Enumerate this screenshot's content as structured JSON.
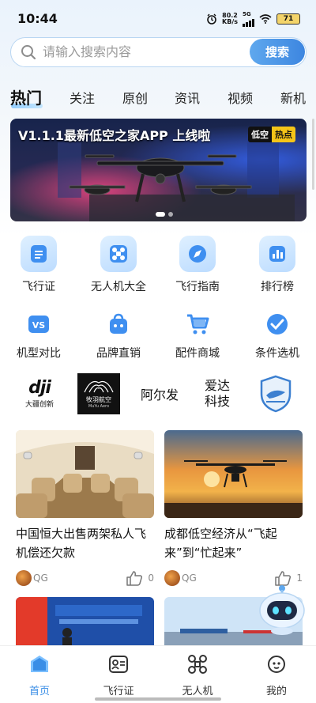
{
  "status_bar": {
    "time": "10:44",
    "net_speed_value": "80.2",
    "net_speed_unit": "KB/s",
    "network_type": "5G",
    "battery": "71"
  },
  "search": {
    "placeholder": "请输入搜索内容",
    "button_label": "搜索"
  },
  "tabs": [
    {
      "label": "热门",
      "active": true
    },
    {
      "label": "关注"
    },
    {
      "label": "原创"
    },
    {
      "label": "资讯"
    },
    {
      "label": "视频"
    },
    {
      "label": "新机"
    }
  ],
  "banner": {
    "title": "V1.1.1最新低空之家APP 上线啦",
    "tag_left": "低空",
    "tag_right": "热点"
  },
  "features": [
    {
      "label": "飞行证",
      "icon": "certificate-icon"
    },
    {
      "label": "无人机大全",
      "icon": "drone-icon"
    },
    {
      "label": "飞行指南",
      "icon": "compass-icon"
    },
    {
      "label": "排行榜",
      "icon": "ranking-icon"
    },
    {
      "label": "机型对比",
      "icon": "versus-icon"
    },
    {
      "label": "品牌直销",
      "icon": "brand-bag-icon"
    },
    {
      "label": "配件商城",
      "icon": "cart-icon"
    },
    {
      "label": "条件选机",
      "icon": "check-filter-icon"
    }
  ],
  "brands": {
    "dji_word": "dji",
    "dji_cn": "大疆创新",
    "muyu_cn": "牧羽航空",
    "muyu_en": "MuYu Aero",
    "aerfa": "阿尔发",
    "aida": "爱达\n科技"
  },
  "articles": [
    {
      "title": "中国恒大出售两架私人飞机偿还欠款",
      "author": "QG",
      "likes": "0"
    },
    {
      "title": "成都低空经济从“飞起来”到“忙起来”",
      "author": "QG",
      "likes": "1"
    }
  ],
  "bottom_nav": [
    {
      "label": "首页",
      "active": true
    },
    {
      "label": "飞行证"
    },
    {
      "label": "无人机"
    },
    {
      "label": "我的"
    }
  ],
  "colors": {
    "accent": "#3a8ee6",
    "tag_yellow": "#f5c518"
  }
}
